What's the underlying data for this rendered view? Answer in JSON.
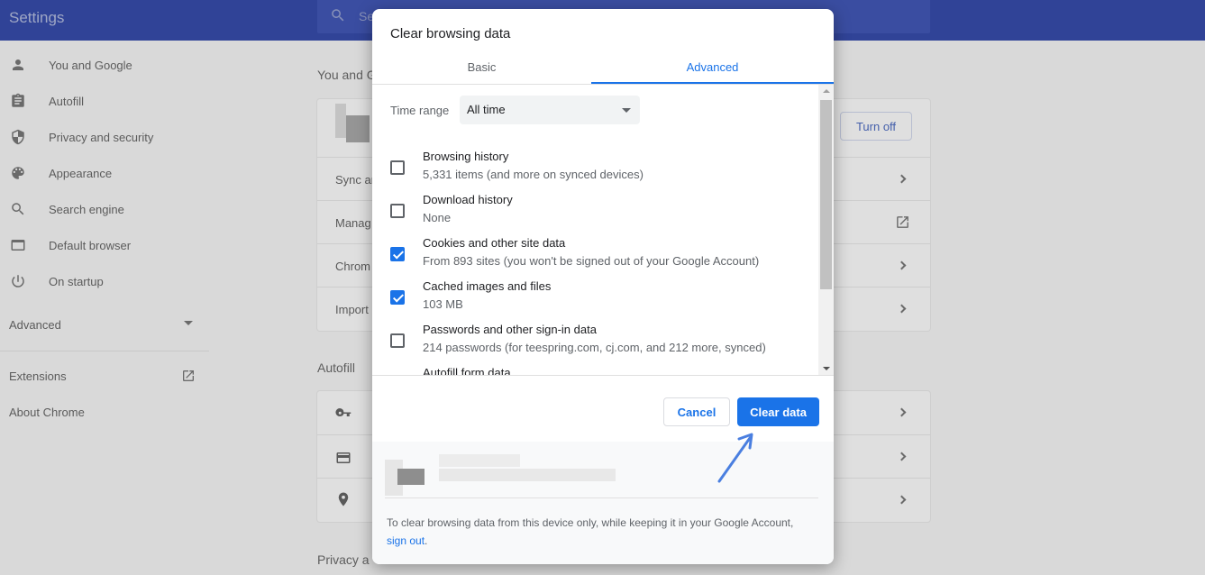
{
  "app": {
    "title": "Settings",
    "search_placeholder": "Se"
  },
  "sidebar": {
    "items": [
      {
        "label": "You and Google",
        "icon": "person-icon"
      },
      {
        "label": "Autofill",
        "icon": "clipboard-icon"
      },
      {
        "label": "Privacy and security",
        "icon": "shield-icon"
      },
      {
        "label": "Appearance",
        "icon": "palette-icon"
      },
      {
        "label": "Search engine",
        "icon": "search-icon"
      },
      {
        "label": "Default browser",
        "icon": "browser-icon"
      },
      {
        "label": "On startup",
        "icon": "power-icon"
      }
    ],
    "advanced": "Advanced",
    "extensions": "Extensions",
    "about": "About Chrome"
  },
  "main": {
    "section_you": "You and G",
    "turn_off": "Turn off",
    "rows_you": [
      "Sync ar",
      "Manag",
      "Chrom",
      "Import"
    ],
    "section_autofill": "Autofill",
    "section_privacy": "Privacy a"
  },
  "dialog": {
    "title": "Clear browsing data",
    "tabs": {
      "basic": "Basic",
      "advanced": "Advanced"
    },
    "time_range_label": "Time range",
    "time_range_value": "All time",
    "options": [
      {
        "label": "Browsing history",
        "detail": "5,331 items (and more on synced devices)",
        "checked": false
      },
      {
        "label": "Download history",
        "detail": "None",
        "checked": false
      },
      {
        "label": "Cookies and other site data",
        "detail": "From 893 sites (you won't be signed out of your Google Account)",
        "checked": true
      },
      {
        "label": "Cached images and files",
        "detail": "103 MB",
        "checked": true
      },
      {
        "label": "Passwords and other sign-in data",
        "detail": "214 passwords (for teespring.com, cj.com, and 212 more, synced)",
        "checked": false
      },
      {
        "label": "Autofill form data",
        "detail": "",
        "checked": false
      }
    ],
    "cancel": "Cancel",
    "clear": "Clear data",
    "footer_text": "To clear browsing data from this device only, while keeping it in your Google Account,",
    "footer_link": "sign out",
    "footer_end": "."
  },
  "colors": {
    "accent": "#1a73e8",
    "topbar": "#233aa0"
  }
}
